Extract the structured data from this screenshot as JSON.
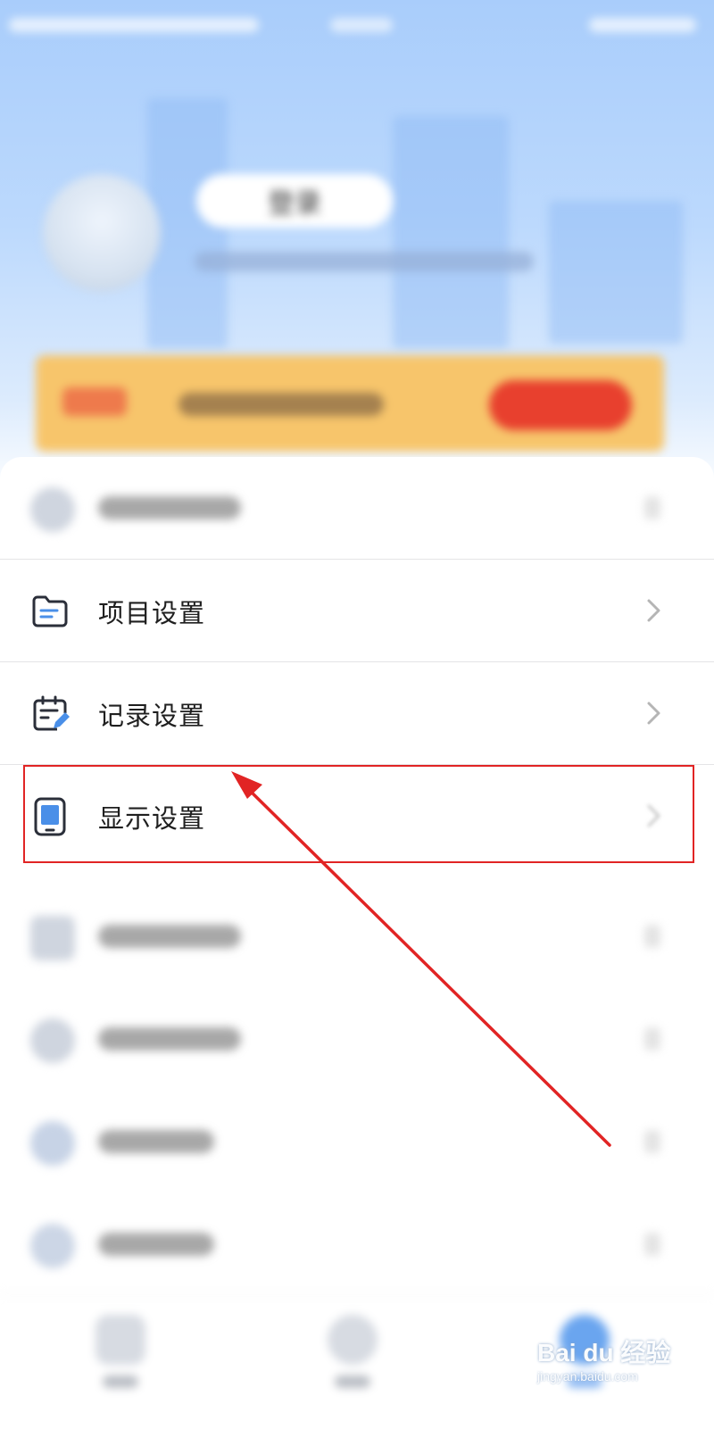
{
  "profile": {
    "name": "登录"
  },
  "settings": {
    "items": [
      {
        "label": "项目设置",
        "icon": "folder-icon"
      },
      {
        "label": "记录设置",
        "icon": "calendar-edit-icon"
      },
      {
        "label": "显示设置",
        "icon": "phone-display-icon",
        "highlighted": true
      }
    ]
  },
  "watermark": {
    "main": "Bai du 经验",
    "sub": "jingyan.baidu.com"
  },
  "colors": {
    "highlight": "#e12424",
    "accent_blue": "#4a8fe8",
    "vip_orange": "#f7c56b"
  }
}
